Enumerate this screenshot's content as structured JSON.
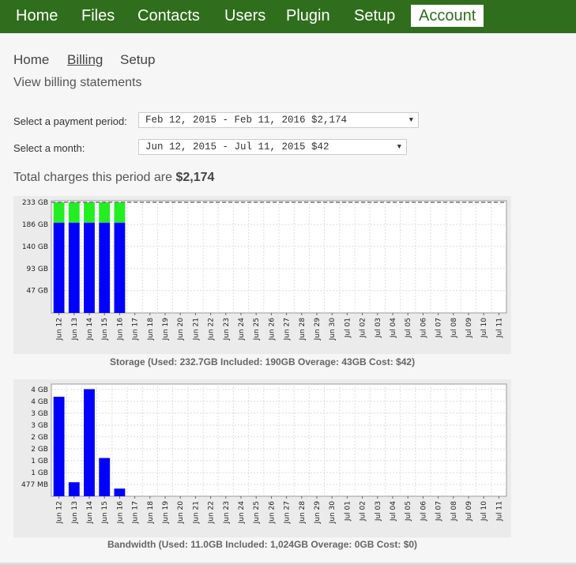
{
  "top_nav": [
    {
      "label": "Home"
    },
    {
      "label": "Files"
    },
    {
      "label": "Contacts"
    },
    {
      "label": "Users"
    },
    {
      "label": "Plugin"
    },
    {
      "label": "Setup"
    },
    {
      "label": "Account",
      "active": true
    }
  ],
  "sub_nav": [
    {
      "label": "Home"
    },
    {
      "label": "Billing",
      "active": true
    },
    {
      "label": "Setup"
    }
  ],
  "description": "View billing statements",
  "form": {
    "period_label": "Select a payment period:",
    "period_value": "Feb 12, 2015 - Feb 11, 2016 $2,174",
    "month_label": "Select a month:",
    "month_value": "Jun 12, 2015 - Jul 11, 2015 $42"
  },
  "total": {
    "prefix": "Total charges this period are ",
    "amount": "$2,174"
  },
  "colors": {
    "nav_bg": "#2f6e1c",
    "used": "#0000ff",
    "overage": "#22ee22"
  },
  "chart_data": [
    {
      "type": "bar",
      "stacked": true,
      "title": "Storage (Used: 232.7GB Included: 190GB Overage: 43GB Cost: $42)",
      "categories": [
        "Jun 12",
        "Jun 13",
        "Jun 14",
        "Jun 15",
        "Jun 16",
        "Jun 17",
        "Jun 18",
        "Jun 19",
        "Jun 20",
        "Jun 21",
        "Jun 22",
        "Jun 23",
        "Jun 24",
        "Jun 25",
        "Jun 26",
        "Jun 27",
        "Jun 28",
        "Jun 29",
        "Jun 30",
        "Jul 01",
        "Jul 02",
        "Jul 03",
        "Jul 04",
        "Jul 05",
        "Jul 06",
        "Jul 07",
        "Jul 08",
        "Jul 09",
        "Jul 10",
        "Jul 11"
      ],
      "y_ticks": [
        {
          "label": "233 GB",
          "value": 232.7
        },
        {
          "label": "186 GB",
          "value": 186
        },
        {
          "label": "140 GB",
          "value": 140
        },
        {
          "label": "93 GB",
          "value": 93
        },
        {
          "label": "47 GB",
          "value": 47
        }
      ],
      "ylim": [
        0,
        236
      ],
      "limit_line": 232.7,
      "series": [
        {
          "values": [
            190,
            190,
            190,
            190,
            190,
            0,
            0,
            0,
            0,
            0,
            0,
            0,
            0,
            0,
            0,
            0,
            0,
            0,
            0,
            0,
            0,
            0,
            0,
            0,
            0,
            0,
            0,
            0,
            0,
            0
          ]
        },
        {
          "values": [
            42.7,
            42.7,
            42.7,
            42.7,
            42.7,
            0,
            0,
            0,
            0,
            0,
            0,
            0,
            0,
            0,
            0,
            0,
            0,
            0,
            0,
            0,
            0,
            0,
            0,
            0,
            0,
            0,
            0,
            0,
            0,
            0
          ]
        }
      ]
    },
    {
      "type": "bar",
      "title": "Bandwidth (Used: 11.0GB Included: 1,024GB Overage: 0GB Cost: $0)",
      "categories": [
        "Jun 12",
        "Jun 13",
        "Jun 14",
        "Jun 15",
        "Jun 16",
        "Jun 17",
        "Jun 18",
        "Jun 19",
        "Jun 20",
        "Jun 21",
        "Jun 22",
        "Jun 23",
        "Jun 24",
        "Jun 25",
        "Jun 26",
        "Jun 27",
        "Jun 28",
        "Jun 29",
        "Jun 30",
        "Jul 01",
        "Jul 02",
        "Jul 03",
        "Jul 04",
        "Jul 05",
        "Jul 06",
        "Jul 07",
        "Jul 08",
        "Jul 09",
        "Jul 10",
        "Jul 11"
      ],
      "y_ticks": [
        {
          "label": "4 GB",
          "value": 4.19
        },
        {
          "label": "4 GB",
          "value": 3.72
        },
        {
          "label": "3 GB",
          "value": 3.26
        },
        {
          "label": "3 GB",
          "value": 2.79
        },
        {
          "label": "2 GB",
          "value": 2.33
        },
        {
          "label": "2 GB",
          "value": 1.86
        },
        {
          "label": "1 GB",
          "value": 1.4
        },
        {
          "label": "1 GB",
          "value": 0.93
        },
        {
          "label": "477 MB",
          "value": 0.466
        }
      ],
      "ylim": [
        0,
        4.4
      ],
      "series": [
        {
          "values": [
            3.9,
            0.55,
            4.2,
            1.5,
            0.3,
            0,
            0,
            0,
            0,
            0,
            0,
            0,
            0,
            0,
            0,
            0,
            0,
            0,
            0,
            0,
            0,
            0,
            0,
            0,
            0,
            0,
            0,
            0,
            0,
            0
          ]
        }
      ]
    }
  ]
}
